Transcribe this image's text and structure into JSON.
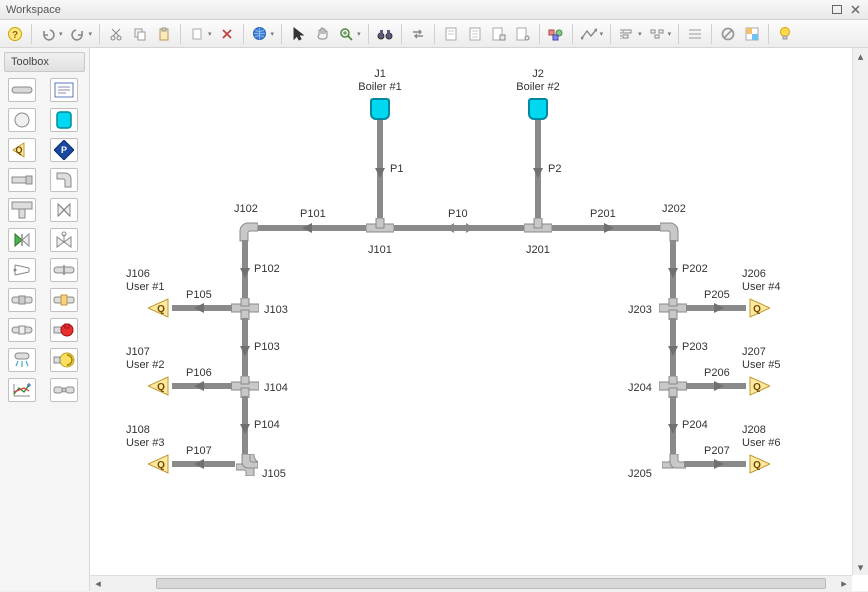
{
  "window": {
    "title": "Workspace"
  },
  "toolbox": {
    "title": "Toolbox"
  },
  "boilers": {
    "j1": {
      "id": "J1",
      "name": "Boiler #1"
    },
    "j2": {
      "id": "J2",
      "name": "Boiler #2"
    }
  },
  "users": {
    "j106": {
      "id": "J106",
      "name": "User #1"
    },
    "j107": {
      "id": "J107",
      "name": "User #2"
    },
    "j108": {
      "id": "J108",
      "name": "User #3"
    },
    "j206": {
      "id": "J206",
      "name": "User #4"
    },
    "j207": {
      "id": "J207",
      "name": "User #5"
    },
    "j208": {
      "id": "J208",
      "name": "User #6"
    }
  },
  "joints": {
    "j101": "J101",
    "j102": "J102",
    "j103": "J103",
    "j104": "J104",
    "j105": "J105",
    "j201": "J201",
    "j202": "J202",
    "j203": "J203",
    "j204": "J204",
    "j205": "J205"
  },
  "pipes": {
    "p1": "P1",
    "p2": "P2",
    "p10": "P10",
    "p101": "P101",
    "p102": "P102",
    "p103": "P103",
    "p104": "P104",
    "p105": "P105",
    "p106": "P106",
    "p107": "P107",
    "p201": "P201",
    "p202": "P202",
    "p203": "P203",
    "p204": "P204",
    "p205": "P205",
    "p206": "P206",
    "p207": "P207"
  }
}
